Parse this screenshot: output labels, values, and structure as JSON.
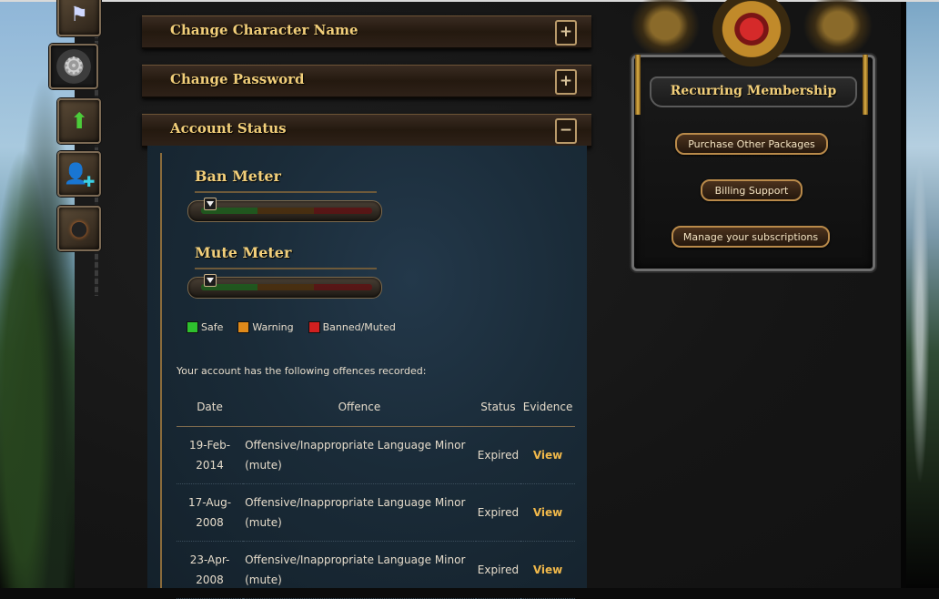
{
  "accordion": {
    "change_name": {
      "title": "Change Character Name",
      "toggle": "+"
    },
    "change_password": {
      "title": "Change Password",
      "toggle": "+"
    },
    "account_status": {
      "title": "Account Status",
      "toggle": "−"
    }
  },
  "account_status": {
    "ban_meter": {
      "title": "Ban Meter",
      "level": 0.05
    },
    "mute_meter": {
      "title": "Mute Meter",
      "level": 0.05
    },
    "legend": [
      {
        "label": "Safe",
        "color": "#2ec02e"
      },
      {
        "label": "Warning",
        "color": "#e08a1a"
      },
      {
        "label": "Banned/Muted",
        "color": "#d12020"
      }
    ],
    "offences_intro": "Your account has the following offences recorded:",
    "table": {
      "headers": {
        "date": "Date",
        "offence": "Offence",
        "status": "Status",
        "evidence": "Evidence"
      },
      "rows": [
        {
          "date": "19-Feb-2014",
          "offence": "Offensive/Inappropriate Language Minor (mute)",
          "status": "Expired",
          "evidence": "View"
        },
        {
          "date": "17-Aug-2008",
          "offence": "Offensive/Inappropriate Language Minor (mute)",
          "status": "Expired",
          "evidence": "View"
        },
        {
          "date": "23-Apr-2008",
          "offence": "Offensive/Inappropriate Language Minor (mute)",
          "status": "Expired",
          "evidence": "View"
        }
      ]
    }
  },
  "membership": {
    "title": "Recurring Membership",
    "purchase_label": "Purchase Other Packages",
    "billing_label": "Billing Support",
    "manage_label": "Manage your subscriptions"
  },
  "icons": [
    "banner-icon",
    "gear-icon",
    "level-up-icon",
    "add-friend-icon",
    "bomb-icon"
  ]
}
